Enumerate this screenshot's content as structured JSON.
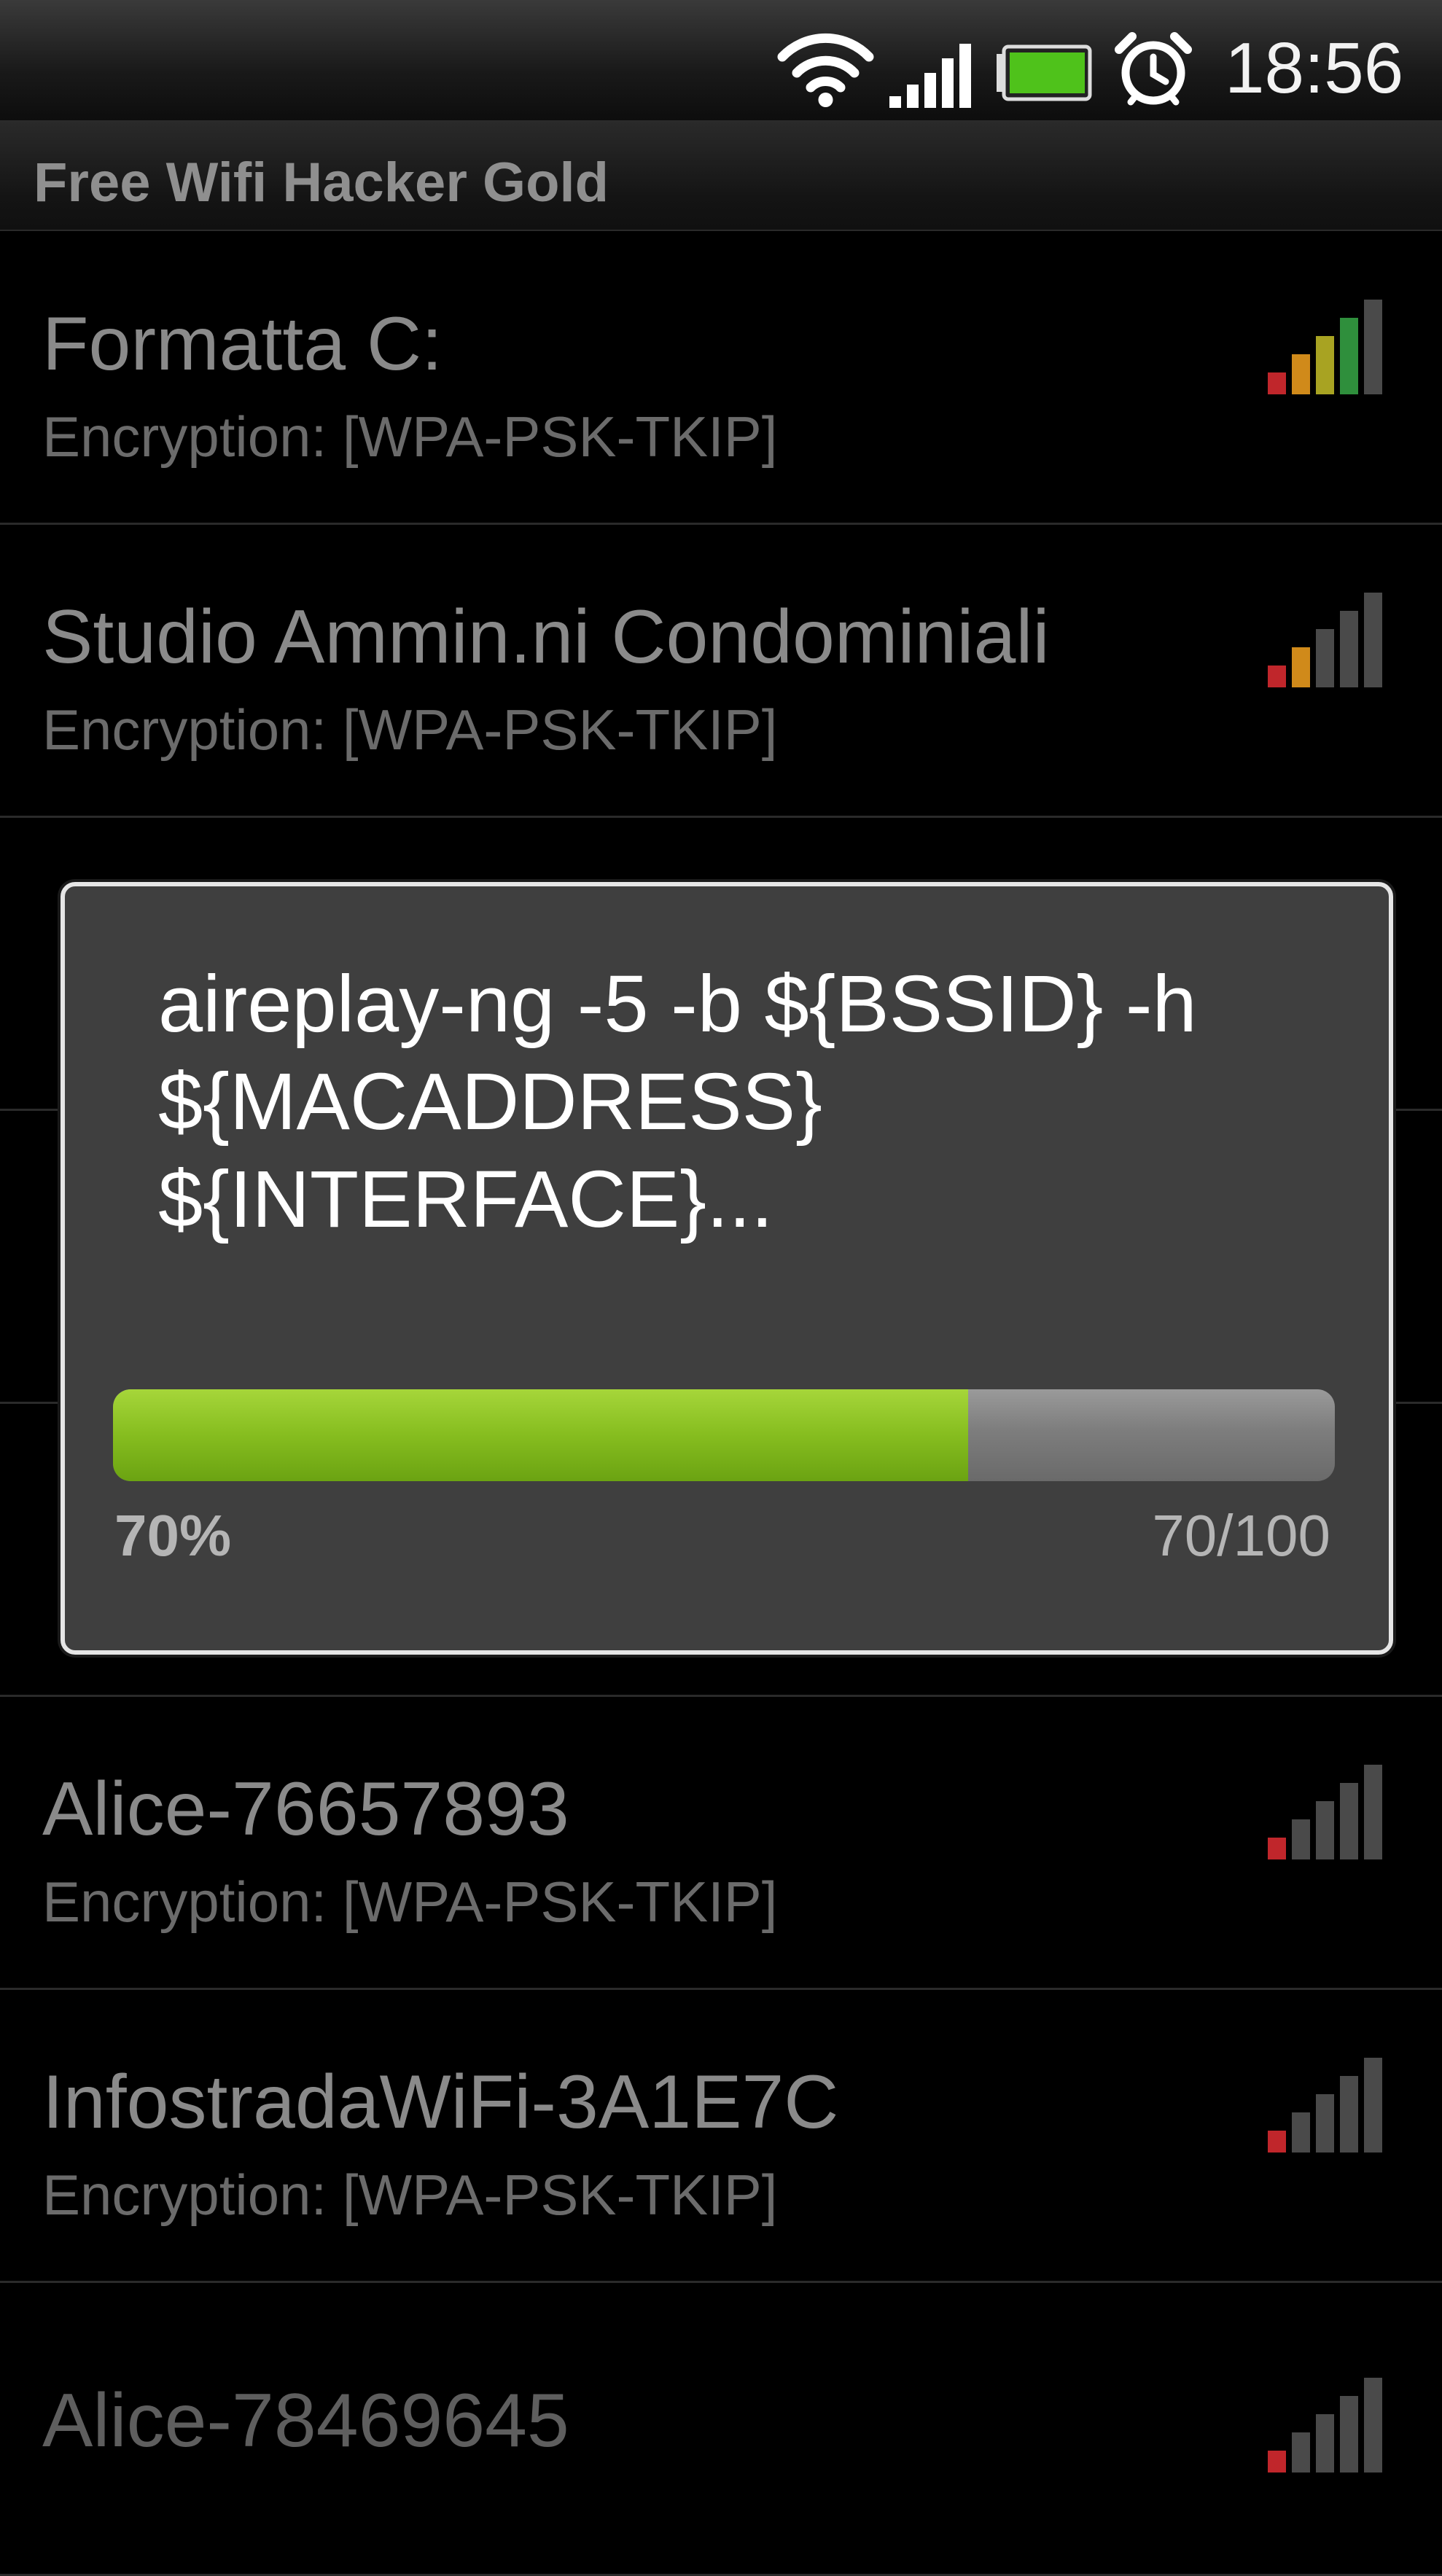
{
  "status_bar": {
    "time": "18:56",
    "icons": [
      "wifi-icon",
      "cell-signal-icon",
      "battery-icon",
      "alarm-clock-icon"
    ]
  },
  "app": {
    "title": "Free Wifi Hacker Gold"
  },
  "networks": [
    {
      "ssid": "Formatta C:",
      "encryption": "Encryption: [WPA-PSK-TKIP]",
      "signal_bars": 4
    },
    {
      "ssid": "Studio Ammin.ni Condominiali",
      "encryption": "Encryption: [WPA-PSK-TKIP]",
      "signal_bars": 2
    },
    {
      "ssid": "",
      "encryption": "",
      "signal_bars": 0
    },
    {
      "ssid": "",
      "encryption": "",
      "signal_bars": 0
    },
    {
      "ssid": "",
      "encryption": "",
      "signal_bars": 0
    },
    {
      "ssid": "Alice-76657893",
      "encryption": "Encryption: [WPA-PSK-TKIP]",
      "signal_bars": 1
    },
    {
      "ssid": "InfostradaWiFi-3A1E7C",
      "encryption": "Encryption: [WPA-PSK-TKIP]",
      "signal_bars": 1
    },
    {
      "ssid": "Alice-78469645",
      "encryption": "",
      "signal_bars": 1
    }
  ],
  "dialog": {
    "message": "aireplay-ng -5 -b ${BSSID} -h ${MACADDRESS} ${INTERFACE}...",
    "progress_fraction": 0.7,
    "progress_percent_label": "70%",
    "progress_count_label": "70/100"
  },
  "colors": {
    "progress_fill": "#86bd1f",
    "progress_track": "#7d7d7d",
    "signal_red": "#c0262b",
    "signal_orange": "#d08a1a",
    "signal_yellow": "#a8a322",
    "signal_green": "#2f8f3c",
    "signal_inactive": "#4a4a4a"
  }
}
